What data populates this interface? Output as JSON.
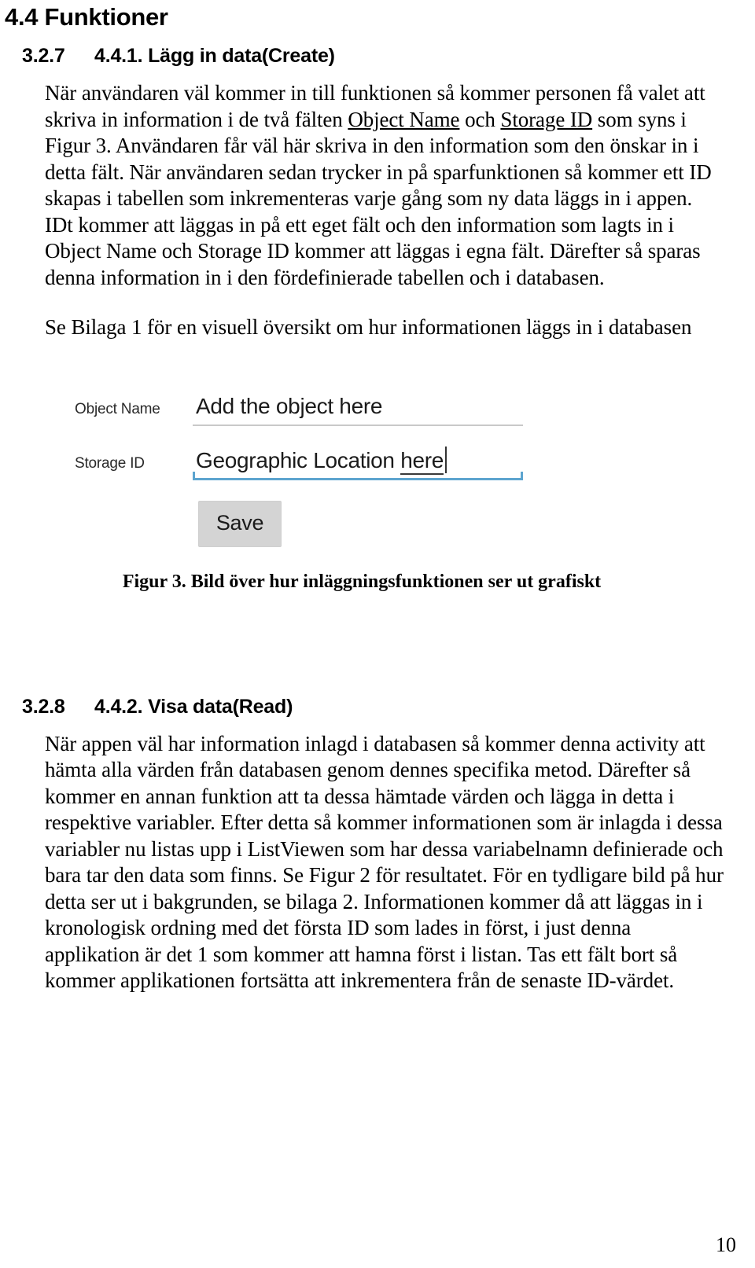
{
  "document": {
    "title": "4.4 Funktioner",
    "page_number": "10"
  },
  "sections": [
    {
      "number": "3.2.7",
      "heading": "4.4.1. Lägg in data(Create)",
      "paragraphs": [
        "När användaren väl kommer in till funktionen så kommer personen få valet att skriva in information i de två fälten ",
        "syns i Figur 3. Användaren får väl här skriva in den information som den önskar in i detta fält. När användaren sedan trycker in på sparfunktionen så kommer ett ID skapas i tabellen som inkrementeras varje gång som ny data läggs in i appen. IDt kommer att läggas in på ett eget fält och den information som lagts in i Object Name och Storage ID kommer att läggas i egna fält. Därefter så sparas denna information in i den fördefinierade tabellen och i databasen.",
        "Se Bilaga 1 för en visuell översikt om hur informationen läggs in i databasen"
      ],
      "inline_links": {
        "object_name": "Object Name",
        "storage_id": "Storage ID",
        "conjunction": " och ",
        "tail": " som "
      }
    },
    {
      "number": "3.2.8",
      "heading": "4.4.2. Visa data(Read)",
      "paragraphs": [
        "När appen väl har information inlagd i databasen så kommer denna activity att hämta alla värden från databasen genom dennes specifika metod. Därefter så kommer en annan funktion att ta dessa hämtade värden och lägga in detta i respektive variabler. Efter detta så kommer informationen som är inlagda i dessa variabler nu listas upp i ListViewen som har dessa variabelnamn definierade och bara tar den data som finns. Se Figur 2 för resultatet. För en tydligare bild på hur detta ser ut i bakgrunden, se bilaga 2. Informationen kommer då att läggas in i kronologisk ordning med det första ID som lades in först, i just denna applikation är det 1 som kommer att hamna först i listan. Tas ett fält bort så kommer applikationen fortsätta att inkrementera från de senaste ID-värdet."
      ]
    }
  ],
  "figure": {
    "caption": "Figur 3. Bild över hur inläggningsfunktionen ser ut grafiskt",
    "form": {
      "fields": [
        {
          "label": "Object Name",
          "value": "Add the object here",
          "focused": false,
          "underline_color": "#c9c9c9"
        },
        {
          "label": "Storage ID",
          "value_prefix": "Geographic Location ",
          "value_misspelled": "here",
          "focused": true,
          "underline_color": "#5ca4cf"
        }
      ],
      "save_label": "Save",
      "save_bg": "#d4d4d4"
    }
  }
}
